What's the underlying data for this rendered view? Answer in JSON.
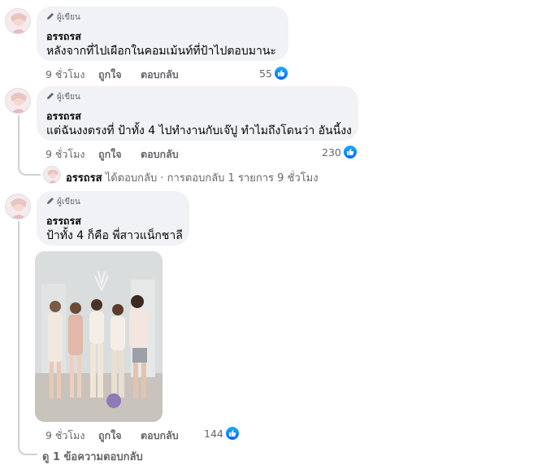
{
  "comments": [
    {
      "author_badge": "ผู้เขียน",
      "name": "อรรถรส",
      "text": "หลังจากที่ไปเผือกในคอมเม้นท์ที่ป้าไปตอบมานะ",
      "time": "9 ชั่วโมง",
      "like_label": "ถูกใจ",
      "reply_label": "ตอบกลับ",
      "reaction_count": "55"
    },
    {
      "author_badge": "ผู้เขียน",
      "name": "อรรถรส",
      "text": "แต่ฉันงงตรงที่ ป้าทั้ง 4 ไปทำงานกับเจ๊ปู ทำไมถึงโดนว่า อันนี้งง",
      "time": "9 ชั่วโมง",
      "like_label": "ถูกใจ",
      "reply_label": "ตอบกลับ",
      "reaction_count": "230",
      "reply_summary": {
        "name": "อรรถรส",
        "text": "ได้ตอบกลับ · การตอบกลับ 1 รายการ",
        "time": "9 ชั่วโมง"
      }
    },
    {
      "author_badge": "ผู้เขียน",
      "name": "อรรถรส",
      "text": "ป้าทั้ง 4 ก็คือ พี่สาวแน็กชาลี",
      "time": "9 ชั่วโมง",
      "like_label": "ถูกใจ",
      "reply_label": "ตอบกลับ",
      "reaction_count": "144",
      "view_replies": "ดู 1 ข้อความตอบกลับ"
    }
  ],
  "icons": {
    "pencil": "pencil-icon",
    "like": "like-icon",
    "avatar": "avatar"
  },
  "colors": {
    "bubble": "#f0f2f5",
    "like_blue": "#0866ff",
    "muted_text": "#65676b"
  }
}
